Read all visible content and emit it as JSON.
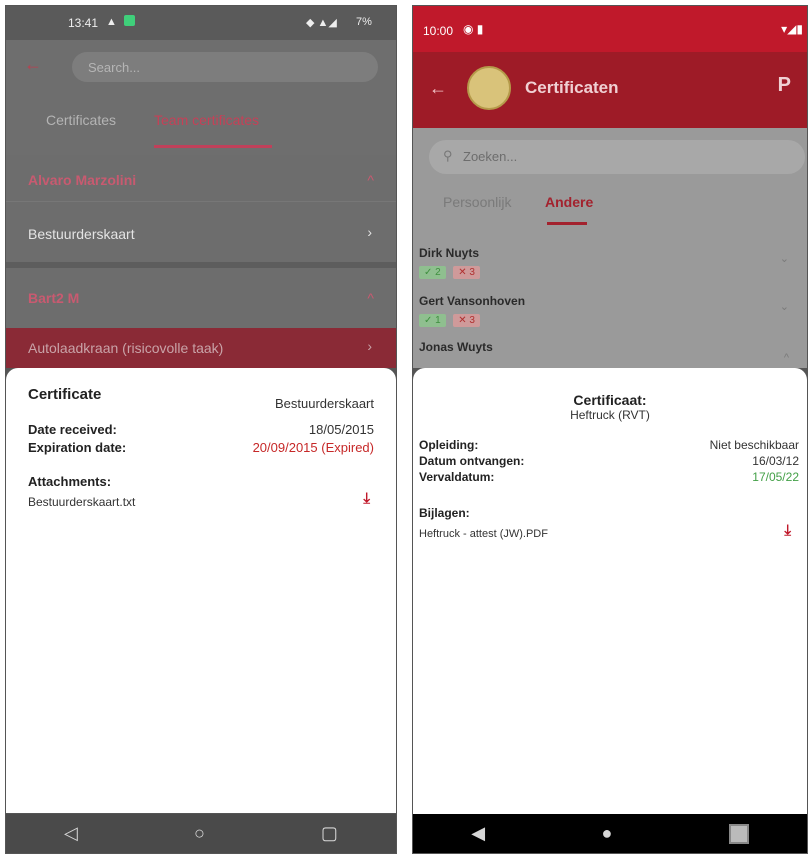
{
  "left": {
    "status_bar": {
      "time": "13:41",
      "right": "7%"
    },
    "search": {
      "placeholder": "Search..."
    },
    "tabs": [
      {
        "label": "Certificates"
      },
      {
        "label": "Team certificates"
      }
    ],
    "people": [
      {
        "name": "Alvaro Marzolini",
        "items": [
          "Bestuurderskaart"
        ]
      },
      {
        "name": "Bart2 M",
        "items": [
          "Autolaadkraan (risicovolle taak)"
        ]
      }
    ],
    "sheet": {
      "title": "Certificate",
      "cert_name": "Bestuurderskaart",
      "date_received_label": "Date received:",
      "date_received": "18/05/2015",
      "expiration_label": "Expiration date:",
      "expiration_value": "20/09/2015 (Expired)",
      "attachments_label": "Attachments:",
      "attachment_file": "Bestuurderskaart.txt"
    }
  },
  "right": {
    "status_bar": {
      "time": "10:00"
    },
    "app_bar": {
      "title": "Certificaten"
    },
    "search": {
      "placeholder": "Zoeken..."
    },
    "tabs": [
      {
        "label": "Persoonlijk"
      },
      {
        "label": "Andere"
      }
    ],
    "people": [
      {
        "name": "Dirk Nuyts",
        "ok": "2",
        "bad": "3"
      },
      {
        "name": "Gert Vansonhoven",
        "ok": "1",
        "bad": "3"
      },
      {
        "name": "Jonas Wuyts"
      }
    ],
    "sheet": {
      "title": "Certificaat:",
      "subtitle": "Heftruck (RVT)",
      "training_label": "Opleiding:",
      "training_value": "Niet beschikbaar",
      "received_label": "Datum ontvangen:",
      "received_value": "16/03/12",
      "expiry_label": "Vervaldatum:",
      "expiry_value": "17/05/22",
      "attachments_label": "Bijlagen:",
      "attachment_file": "Heftruck - attest (JW).PDF"
    }
  },
  "colors": {
    "brand_red": "#c0192b",
    "expired_red": "#c62828",
    "valid_green": "#43a047"
  }
}
